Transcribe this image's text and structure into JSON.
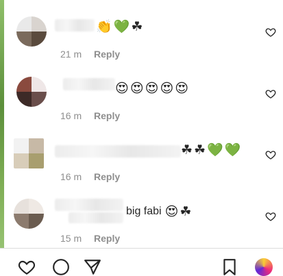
{
  "comments": [
    {
      "emojis": [
        "👏",
        "💚",
        "☘"
      ],
      "text": "",
      "time": "21 m",
      "reply_label": "Reply"
    },
    {
      "emojis": [
        "😍",
        "😍",
        "😍",
        "😍",
        "😍"
      ],
      "text": "",
      "time": "16 m",
      "reply_label": "Reply"
    },
    {
      "emojis": [
        "☘",
        "☘",
        "💚",
        "💚"
      ],
      "text": "",
      "time": "16 m",
      "reply_label": "Reply"
    },
    {
      "emojis": [
        "😍",
        "☘"
      ],
      "text": "big fabi",
      "time": "15 m",
      "reply_label": "Reply"
    }
  ],
  "icons": {
    "like": "heart-outline-icon",
    "bottom": [
      "heart-icon",
      "comment-icon",
      "share-icon",
      "bookmark-icon",
      "avatar-icon"
    ]
  },
  "colors": {
    "meta_text": "#8e8e8e",
    "text": "#262626",
    "divider": "#dbdbdb"
  }
}
